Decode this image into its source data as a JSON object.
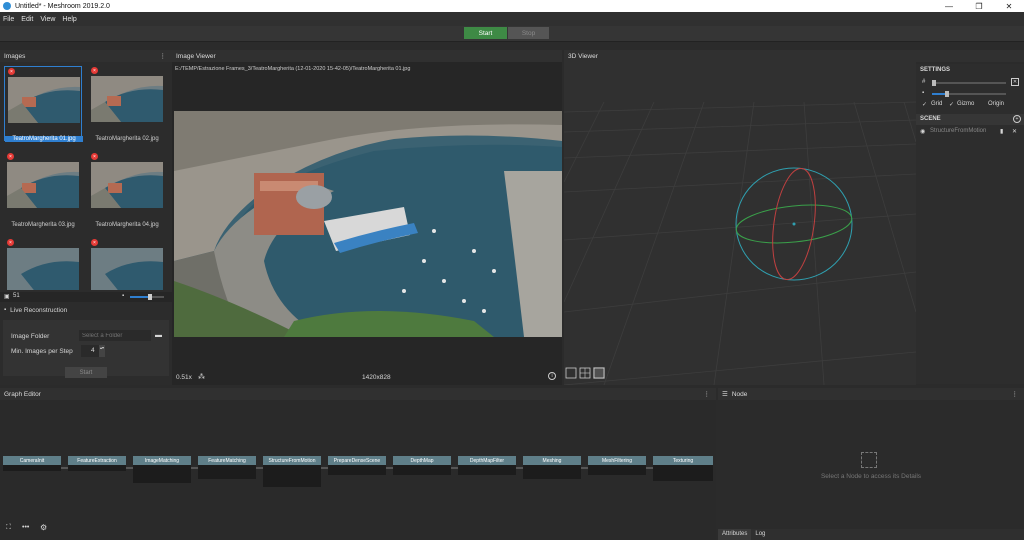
{
  "window": {
    "title": "Untitled* - Meshroom 2019.2.0",
    "minimize": "—",
    "maximize": "❐",
    "close": "✕"
  },
  "menu": [
    "File",
    "Edit",
    "View",
    "Help"
  ],
  "toolbar": {
    "start_label": "Start",
    "stop_label": "Stop"
  },
  "images": {
    "header": "Images",
    "more_icon": "⋮",
    "items": [
      {
        "name": "TeatroMargherita 01.jpg",
        "selected": true
      },
      {
        "name": "TeatroMargherita 02.jpg"
      },
      {
        "name": "TeatroMargherita 03.jpg"
      },
      {
        "name": "TeatroMargherita 04.jpg"
      },
      {
        "name": ""
      },
      {
        "name": ""
      }
    ],
    "count": "51"
  },
  "live": {
    "header": "Live Reconstruction",
    "image_folder_label": "Image Folder",
    "image_folder_placeholder": "Select a Folder",
    "min_images_label": "Min. Images per Step",
    "min_images_value": "4",
    "start_label": "Start"
  },
  "image_viewer": {
    "header": "Image Viewer",
    "path": "E:/TEMP/Estrazione Frames_3/TeatroMargherita (12-01-2020 15-42-05)/TeatroMargherita 01.jpg",
    "zoom": "0.51x",
    "resolution": "1420x828"
  },
  "viewer3d": {
    "header": "3D Viewer",
    "settings_label": "SETTINGS",
    "grid_label": "Grid",
    "gizmo_label": "Gizmo",
    "origin_label": "Origin",
    "scene_label": "SCENE",
    "scene_item": "StructureFromMotion"
  },
  "graph": {
    "header": "Graph Editor",
    "more_icon": "⋮",
    "nodes": [
      "CameraInit",
      "FeatureExtraction",
      "ImageMatching",
      "FeatureMatching",
      "StructureFromMotion",
      "PrepareDenseScene",
      "DepthMap",
      "DepthMapFilter",
      "Meshing",
      "MeshFiltering",
      "Texturing"
    ]
  },
  "node_panel": {
    "header": "Node",
    "more_icon": "⋮",
    "placeholder": "Select a Node to access its Details",
    "tabs": [
      "Attributes",
      "Log"
    ]
  },
  "colors": {
    "accent": "#2f7fd0",
    "start": "#3e8a45",
    "node": "#5f7f89"
  }
}
